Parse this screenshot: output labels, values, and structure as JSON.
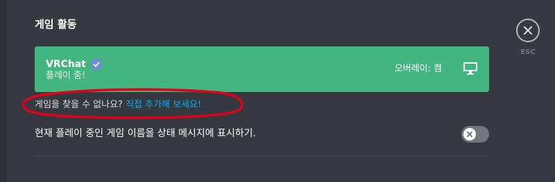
{
  "section": {
    "title": "게임 활동"
  },
  "game_card": {
    "name": "VRChat",
    "status": "플레이 중!",
    "overlay_status": "오버레이: 켬",
    "icon": "monitor-icon",
    "verified_icon": "verified-check-icon"
  },
  "missing_game": {
    "prompt": "게임을 찾을 수 없나요? ",
    "link": "직접 추가해 보세요!"
  },
  "setting": {
    "label": "현재 플레이 중인 게임 이름을 상태 메시지에 표시하기.",
    "enabled": false
  },
  "close": {
    "label": "ESC",
    "icon": "close-icon"
  },
  "colors": {
    "background": "#36393f",
    "card": "#43b581",
    "link": "#00b0f4",
    "annotation": "#e3001b",
    "toggle_off": "#72767d",
    "verified": "#7289da"
  }
}
